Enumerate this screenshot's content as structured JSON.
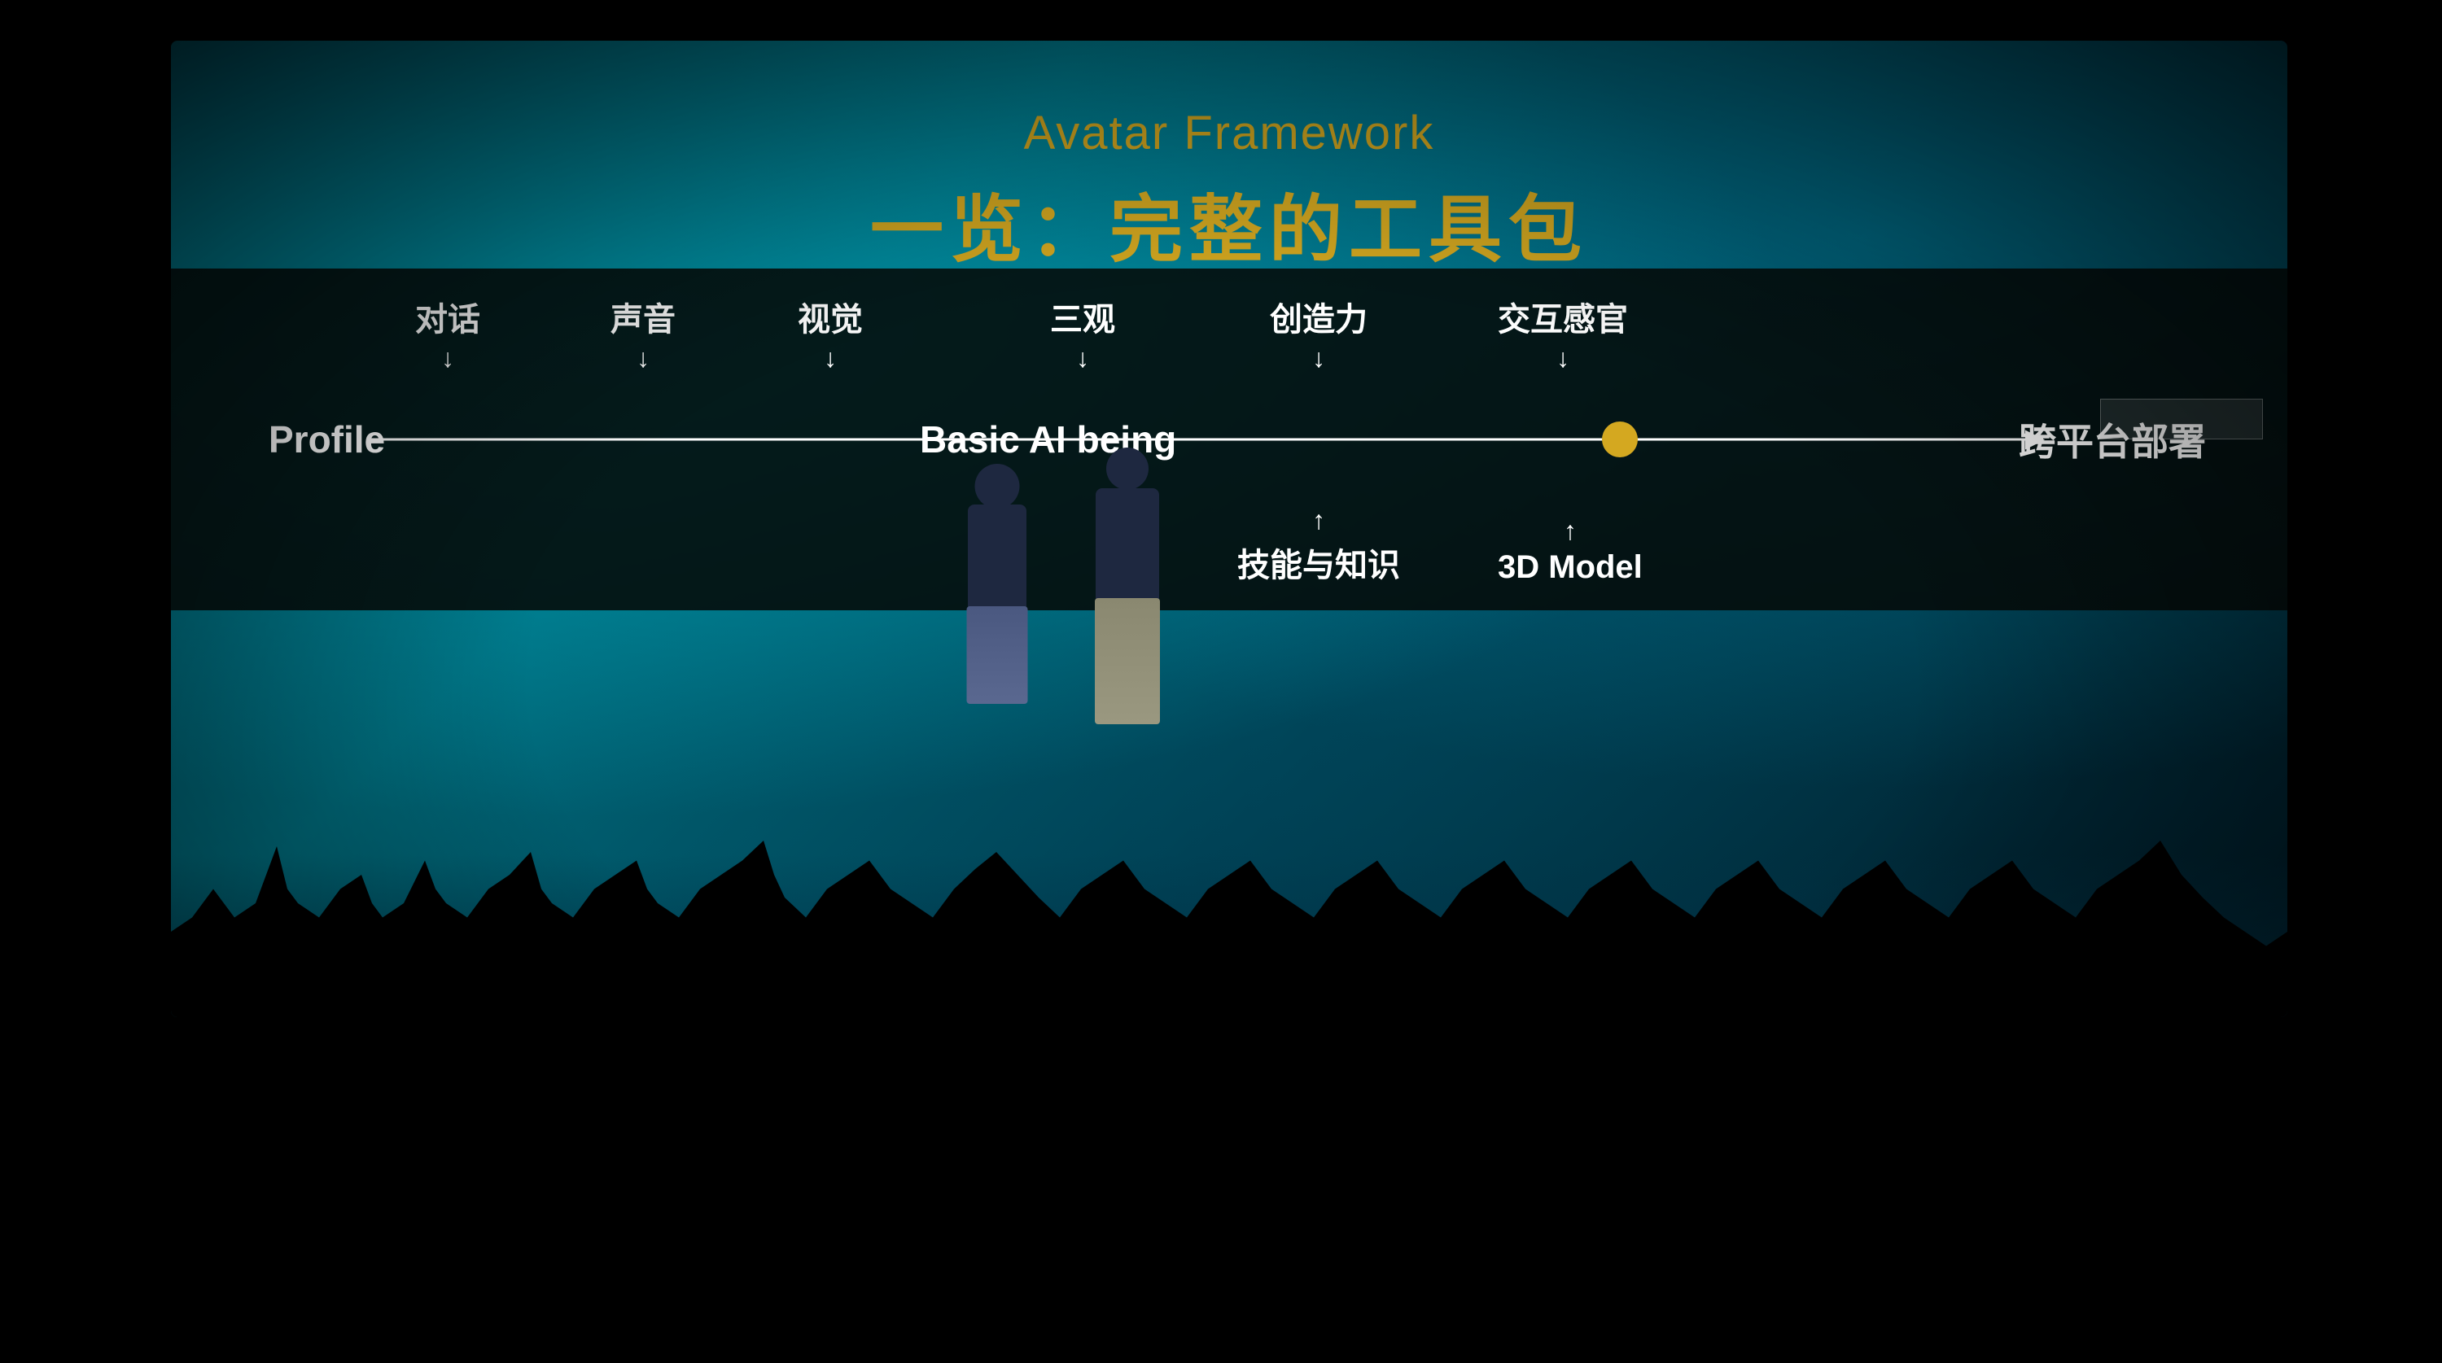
{
  "slide": {
    "title_en": "Avatar Framework",
    "title_zh": "一览：完整的工具包",
    "diagram": {
      "label_left": "Profile",
      "label_center": "Basic AI being",
      "label_right": "跨平台部署",
      "labels_top": [
        {
          "text": "对话",
          "position": 290
        },
        {
          "text": "声音",
          "position": 530
        },
        {
          "text": "视觉",
          "position": 760
        },
        {
          "text": "三观",
          "position": 1050
        },
        {
          "text": "创造力",
          "position": 1340
        },
        {
          "text": "交互感官",
          "position": 1620
        }
      ],
      "labels_bottom": [
        {
          "text": "技能与知识",
          "position": 1340
        },
        {
          "text": "3D Model",
          "position": 1620
        }
      ]
    }
  }
}
